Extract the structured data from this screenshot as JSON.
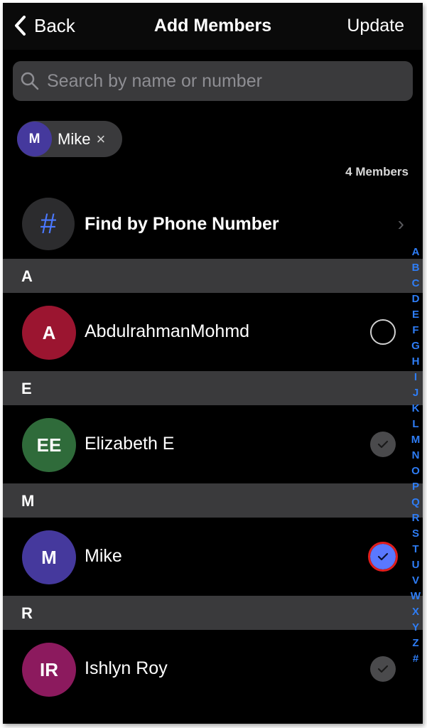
{
  "nav": {
    "back_label": "Back",
    "title": "Add Members",
    "action_label": "Update"
  },
  "search": {
    "placeholder": "Search by name or number",
    "value": ""
  },
  "selected_chips": [
    {
      "initial": "M",
      "name": "Mike",
      "remove_symbol": "×"
    }
  ],
  "member_count_label": "4 Members",
  "find_by_phone": {
    "icon_symbol": "#",
    "label": "Find by Phone Number",
    "chevron": "›"
  },
  "sections": [
    {
      "letter": "A",
      "contacts": [
        {
          "initials": "A",
          "name": "AbdulrahmanMohmd",
          "avatar_color": "#9b1530",
          "state": "unselected"
        }
      ]
    },
    {
      "letter": "E",
      "contacts": [
        {
          "initials": "EE",
          "name": "Elizabeth E",
          "avatar_color": "#2f6b3a",
          "state": "already-member"
        }
      ]
    },
    {
      "letter": "M",
      "contacts": [
        {
          "initials": "M",
          "name": "Mike",
          "avatar_color": "#45399d",
          "state": "selected"
        }
      ]
    },
    {
      "letter": "R",
      "contacts": [
        {
          "initials": "IR",
          "name": "Ishlyn Roy",
          "avatar_color": "#8c1a5e",
          "state": "already-member"
        }
      ]
    }
  ],
  "index_letters": [
    "A",
    "B",
    "C",
    "D",
    "E",
    "F",
    "G",
    "H",
    "I",
    "J",
    "K",
    "L",
    "M",
    "N",
    "O",
    "P",
    "Q",
    "R",
    "S",
    "T",
    "U",
    "V",
    "W",
    "X",
    "Y",
    "Z",
    "#"
  ],
  "colors": {
    "accent": "#2e7df6",
    "checkbox_selected": "#5a78ff",
    "highlight_outline": "#e11d1d"
  }
}
